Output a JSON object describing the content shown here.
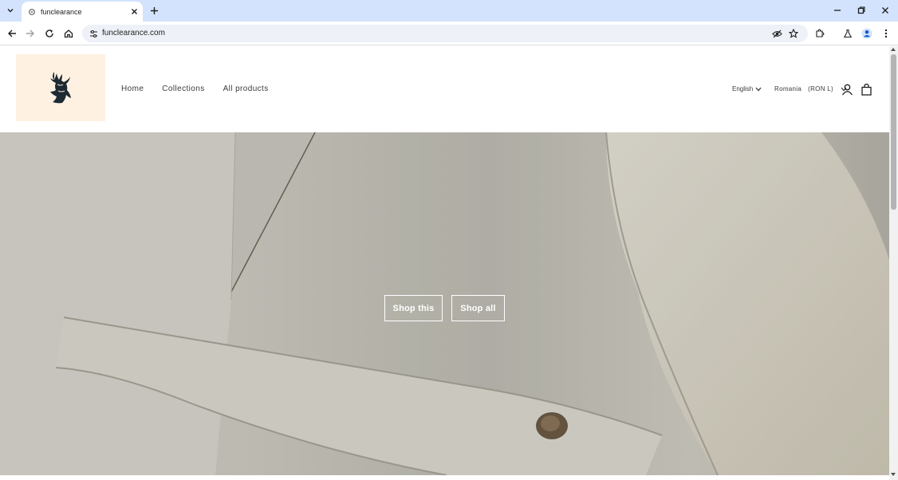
{
  "browser": {
    "tab_title": "funclearance",
    "url": "funclearance.com"
  },
  "icons": {
    "tab_list": "chevron-down-icon",
    "favicon": "site-settings-icon",
    "tab_close": "close-icon",
    "new_tab": "plus-icon",
    "minimize": "minimize-icon",
    "restore": "restore-icon",
    "close_window": "close-icon",
    "back": "arrow-left-icon",
    "forward": "arrow-right-icon",
    "reload": "reload-icon",
    "home": "home-icon",
    "site_info": "tune-icon",
    "eye_off": "eye-off-icon",
    "bookmark": "star-icon",
    "extensions": "puzzle-icon",
    "labs": "flask-icon",
    "profile": "person-icon",
    "menu": "more-vert-icon",
    "logo": "stag-head-icon",
    "account": "account-icon",
    "cart": "shopping-bag-icon"
  },
  "nav": {
    "items": [
      "Home",
      "Collections",
      "All products"
    ]
  },
  "localization": {
    "language": "English",
    "country": "Romania",
    "currency": "(RON L)"
  },
  "hero": {
    "buttons": [
      "Shop this",
      "Shop all"
    ]
  },
  "colors": {
    "tabbar": "#d3e3fd",
    "logo_bg": "#fef1e2",
    "hero_tone": "#c9c6bd"
  }
}
